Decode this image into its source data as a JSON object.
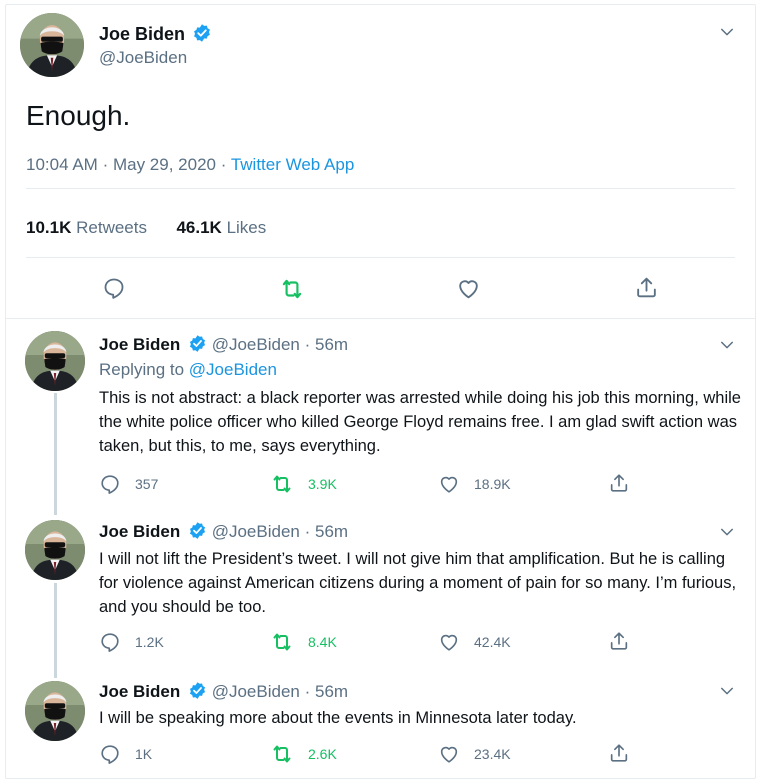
{
  "main_tweet": {
    "name": "Joe Biden",
    "handle": "@JoeBiden",
    "text": "Enough.",
    "time": "10:04 AM",
    "date": "May 29, 2020",
    "source": "Twitter Web App",
    "retweets_count": "10.1K",
    "retweets_label": "Retweets",
    "likes_count": "46.1K",
    "likes_label": "Likes"
  },
  "replies": [
    {
      "name": "Joe Biden",
      "handle": "@JoeBiden",
      "age": "56m",
      "replying_prefix": "Replying to",
      "replying_to": "@JoeBiden",
      "text": "This is not abstract: a black reporter was arrested while doing his job this morning, while the white police officer who killed George Floyd remains free. I am glad swift action was taken, but this, to me, says everything.",
      "replies": "357",
      "retweets": "3.9K",
      "likes": "18.9K"
    },
    {
      "name": "Joe Biden",
      "handle": "@JoeBiden",
      "age": "56m",
      "text": "I will not lift the President’s tweet. I will not give him that amplification. But he is calling for violence against American citizens during a moment of pain for so many. I’m furious, and you should be too.",
      "replies": "1.2K",
      "retweets": "8.4K",
      "likes": "42.4K"
    },
    {
      "name": "Joe Biden",
      "handle": "@JoeBiden",
      "age": "56m",
      "text": "I will be speaking more about the events in Minnesota later today.",
      "replies": "1K",
      "retweets": "2.6K",
      "likes": "23.4K"
    }
  ],
  "separator": "·",
  "colors": {
    "accent": "#1da1f2",
    "retweet_green": "#17bf63",
    "muted": "#5b7083",
    "link": "#1b95e0"
  },
  "icons": [
    "verified-badge-icon",
    "chevron-down-icon",
    "reply-icon",
    "retweet-icon",
    "like-icon",
    "share-icon"
  ]
}
